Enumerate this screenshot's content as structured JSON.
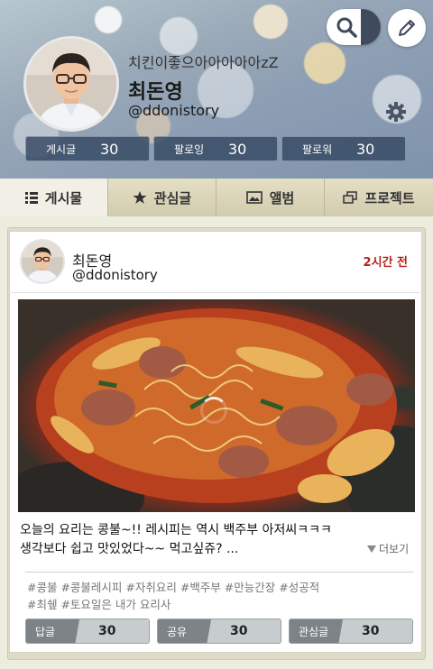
{
  "header": {
    "status_message": "치킨이좋으아아아아아zZ",
    "name": "최돈영",
    "handle": "@ddonistory",
    "stats": [
      {
        "label": "게시글",
        "value": "30"
      },
      {
        "label": "팔로잉",
        "value": "30"
      },
      {
        "label": "팔로워",
        "value": "30"
      }
    ]
  },
  "tabs": [
    {
      "label": "게시물",
      "icon": "list-icon"
    },
    {
      "label": "관심글",
      "icon": "star-icon"
    },
    {
      "label": "앨범",
      "icon": "image-icon"
    },
    {
      "label": "프로젝트",
      "icon": "project-icon"
    }
  ],
  "post": {
    "author_name": "최돈영",
    "author_handle": "@ddonistory",
    "time": "2시간 전",
    "text_line1": "오늘의 요리는 콩불~!! 레시피는 역시 백주부 아저씨ㅋㅋㅋ",
    "text_line2": "생각보다 쉽고 맛있었다~~ 먹고싶쥬? ...",
    "more_label": "더보기",
    "tags_line1": "#콩불 #콩불레시피 #자취요리 #백주부 #만능간장 #성공적",
    "tags_line2": "#최쉪 #토요일은 내가 요리사",
    "actions": [
      {
        "label": "답글",
        "value": "30"
      },
      {
        "label": "공유",
        "value": "30"
      },
      {
        "label": "관심글",
        "value": "30"
      }
    ]
  },
  "colors": {
    "time_red": "#b3221b",
    "stat_bg": "#344862",
    "tab_bg": "#dcd7bf"
  }
}
